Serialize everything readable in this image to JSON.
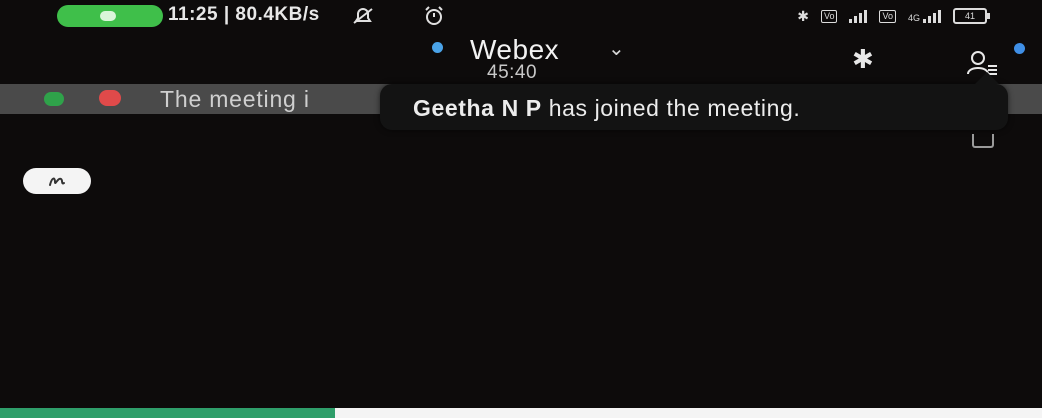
{
  "status_bar": {
    "text": "11:25 | 80.4KB/s",
    "network_label": "4G",
    "battery_label": "41",
    "icons": [
      "call-pill",
      "no-notification-icon",
      "alarm-icon",
      "bluetooth-icon",
      "volte-icon",
      "signal-icon",
      "volte-icon",
      "signal-4g-icon",
      "battery-icon"
    ]
  },
  "header": {
    "title": "Webex",
    "timer": "45:40",
    "icons": [
      "chevron-down-icon",
      "bluetooth-icon",
      "participants-icon"
    ]
  },
  "banner": {
    "text": "The meeting i"
  },
  "toast": {
    "name": "Geetha N P",
    "message": " has joined the meeting."
  },
  "colors": {
    "background": "#0d0b0b",
    "call_pill": "#3fbf4a",
    "accent_blue": "#4aa3e8",
    "banner_bg": "#4a4a4a",
    "banner_green": "#2fa24a",
    "banner_red": "#e04a4a",
    "bottom_green": "#2e9e6a"
  },
  "annotation_button": {
    "icon": "pen-icon"
  }
}
